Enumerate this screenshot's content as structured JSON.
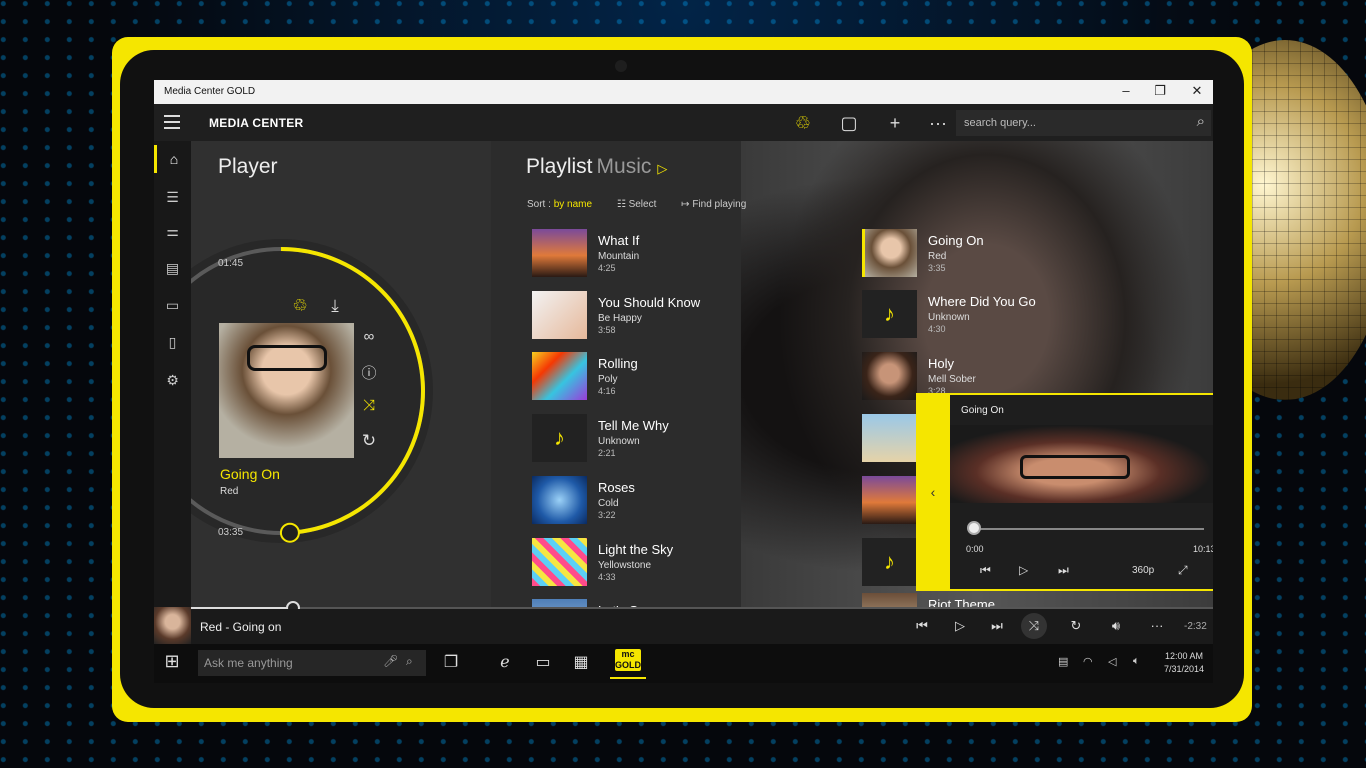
{
  "window": {
    "title": "Media Center GOLD",
    "controls": [
      "minimize-icon",
      "maximize-icon",
      "close-icon"
    ]
  },
  "appbar": {
    "title": "MEDIA CENTER",
    "icons": [
      "share-icon",
      "pin-icon",
      "add-icon",
      "more-icon"
    ],
    "search": {
      "placeholder": "search query...",
      "value": ""
    }
  },
  "rail": {
    "items": [
      {
        "name": "home",
        "icon": "home-icon",
        "active": true
      },
      {
        "name": "playlist",
        "icon": "playlist-icon"
      },
      {
        "name": "equalizer",
        "icon": "equalizer-icon"
      },
      {
        "name": "radio",
        "icon": "radio-icon"
      },
      {
        "name": "cast",
        "icon": "cast-icon"
      },
      {
        "name": "usb",
        "icon": "usb-icon"
      },
      {
        "name": "settings",
        "icon": "settings-icon"
      }
    ]
  },
  "player": {
    "heading": "Player",
    "elapsed": "01:45",
    "total": "03:35",
    "progress_fraction": 0.49,
    "title": "Going On",
    "artist": "Red",
    "accent": "#f5e600"
  },
  "playlist": {
    "heading": "Playlist",
    "subheading": "Music",
    "sort_label": "Sort :",
    "sort_value": "by name",
    "select_label": "Select",
    "find_label": "Find playing",
    "tracks_left": [
      {
        "title": "What If",
        "artist": "Mountain",
        "duration": "4:25"
      },
      {
        "title": "You Should Know",
        "artist": "Be Happy",
        "duration": "3:58"
      },
      {
        "title": "Rolling",
        "artist": "Poly",
        "duration": "4:16"
      },
      {
        "title": "Tell Me Why",
        "artist": "Unknown",
        "duration": "2:21"
      },
      {
        "title": "Roses",
        "artist": "Cold",
        "duration": "3:22"
      },
      {
        "title": "Light the Sky",
        "artist": "Yellowstone",
        "duration": "4:33"
      },
      {
        "title": "Let's Go",
        "artist": "Tracks",
        "duration": ""
      }
    ],
    "tracks_right": [
      {
        "title": "Going On",
        "artist": "Red",
        "duration": "3:35",
        "current": true
      },
      {
        "title": "Where Did You Go",
        "artist": "Unknown",
        "duration": "4:30"
      },
      {
        "title": "Holy",
        "artist": "Mell Sober",
        "duration": "3:28"
      },
      {
        "title": "Riot Theme",
        "artist": "",
        "duration": ""
      }
    ]
  },
  "video": {
    "title": "Going On",
    "elapsed": "0:00",
    "total": "10:13",
    "quality": "360p",
    "progress_fraction": 0.0
  },
  "playback_bar": {
    "now_playing": "Red - Going on",
    "remaining": "-2:32",
    "seek_fraction": 0.1
  },
  "taskbar": {
    "search_placeholder": "Ask me anything",
    "app_logo_top": "mc",
    "app_logo_bottom": "GOLD",
    "time": "12:00 AM",
    "date": "7/31/2014"
  }
}
